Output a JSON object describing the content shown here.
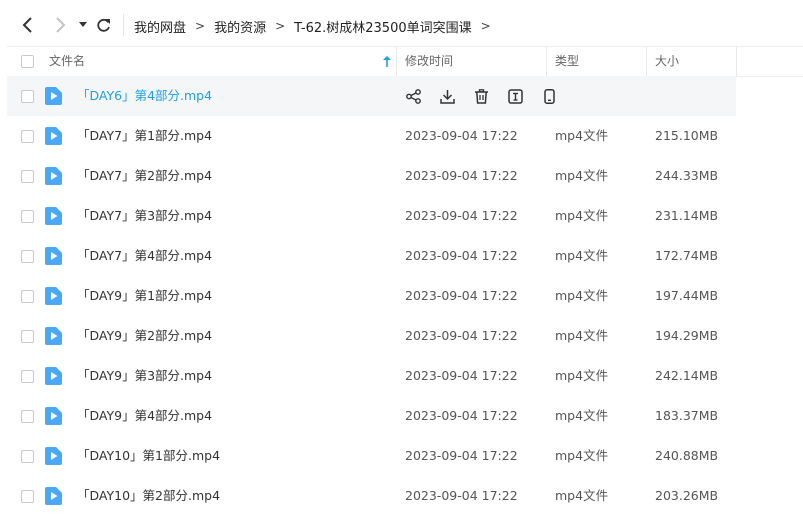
{
  "nav": {
    "crumbs": [
      "我的网盘",
      "我的资源",
      "T-62.树成林23500单词突围课"
    ],
    "separator": ">"
  },
  "table": {
    "headers": {
      "name": "文件名",
      "modified": "修改时间",
      "type": "类型",
      "size": "大小"
    }
  },
  "hover_row": {
    "name": "「DAY6」第4部分.mp4",
    "actions": [
      "share-icon",
      "download-icon",
      "delete-icon",
      "rename-icon",
      "mobile-icon"
    ]
  },
  "rows": [
    {
      "name": "「DAY7」第1部分.mp4",
      "modified": "2023-09-04 17:22",
      "type": "mp4文件",
      "size": "215.10MB"
    },
    {
      "name": "「DAY7」第2部分.mp4",
      "modified": "2023-09-04 17:22",
      "type": "mp4文件",
      "size": "244.33MB"
    },
    {
      "name": "「DAY7」第3部分.mp4",
      "modified": "2023-09-04 17:22",
      "type": "mp4文件",
      "size": "231.14MB"
    },
    {
      "name": "「DAY7」第4部分.mp4",
      "modified": "2023-09-04 17:22",
      "type": "mp4文件",
      "size": "172.74MB"
    },
    {
      "name": "「DAY9」第1部分.mp4",
      "modified": "2023-09-04 17:22",
      "type": "mp4文件",
      "size": "197.44MB"
    },
    {
      "name": "「DAY9」第2部分.mp4",
      "modified": "2023-09-04 17:22",
      "type": "mp4文件",
      "size": "194.29MB"
    },
    {
      "name": "「DAY9」第3部分.mp4",
      "modified": "2023-09-04 17:22",
      "type": "mp4文件",
      "size": "242.14MB"
    },
    {
      "name": "「DAY9」第4部分.mp4",
      "modified": "2023-09-04 17:22",
      "type": "mp4文件",
      "size": "183.37MB"
    },
    {
      "name": "「DAY10」第1部分.mp4",
      "modified": "2023-09-04 17:22",
      "type": "mp4文件",
      "size": "240.88MB"
    },
    {
      "name": "「DAY10」第2部分.mp4",
      "modified": "2023-09-04 17:22",
      "type": "mp4文件",
      "size": "203.26MB"
    }
  ],
  "colors": {
    "accent": "#1e9fe6",
    "file_icon": "#4aa8f5"
  }
}
